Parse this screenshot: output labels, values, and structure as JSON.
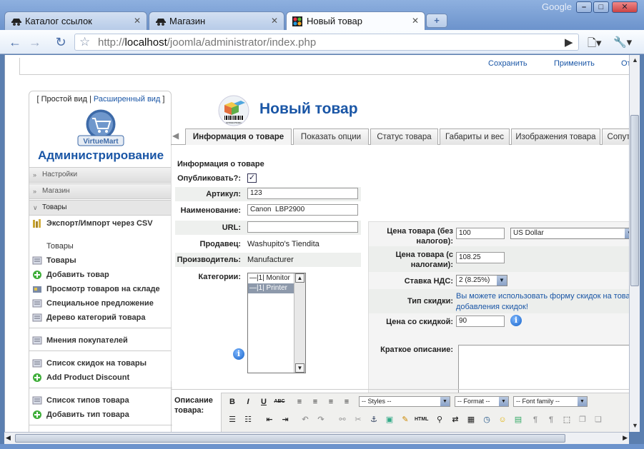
{
  "browser": {
    "tabs": [
      {
        "label": "Каталог ссылок",
        "icon": "spy-icon"
      },
      {
        "label": "Магазин",
        "icon": "spy-icon"
      },
      {
        "label": "Новый товар",
        "icon": "joomla-icon"
      }
    ],
    "new_tab": "+",
    "brand": "Google",
    "url_prefix": "http://",
    "url_host": "localhost",
    "url_path": "/joomla/administrator/index.php"
  },
  "top_actions": {
    "save": "Сохранить",
    "apply": "Применить",
    "cancel": "От"
  },
  "sidebar": {
    "view_open": "[",
    "simple_view": "Простой вид",
    "view_sep": "|",
    "extended_view": "Расширенный вид",
    "view_close": "]",
    "logo_text": "VirtueMart",
    "title": "Администрирование",
    "sections": [
      "Настройки",
      "Магазин",
      "Товары"
    ],
    "export": "Экспорт/Импорт через CSV",
    "products_heading": "Товары",
    "items": [
      "Товары",
      "Добавить товар",
      "Просмотр товаров на складе",
      "Специальное предложение",
      "Дерево категорий товара",
      "Мнения покупателей",
      "Список скидок на товары",
      "Add Product Discount",
      "Список типов товара",
      "Добавить тип товара"
    ]
  },
  "page": {
    "title": "Новый товар",
    "barcode_text": "6078943756901"
  },
  "tabs": [
    "Информация о товаре",
    "Показать опции",
    "Статус товара",
    "Габариты и вес",
    "Изображения товара",
    "Сопут"
  ],
  "form": {
    "section_title": "Информация о товаре",
    "publish_label": "Опубликовать?:",
    "publish_checked": true,
    "publish_mark": "✓",
    "sku_label": "Артикул:",
    "sku_value": "123",
    "name_label": "Наименование:",
    "name_value": "Canon  LBP2900",
    "url_label": "URL:",
    "url_value": "",
    "vendor_label": "Продавец:",
    "vendor_value": "Washupito's Tiendita",
    "manufacturer_label": "Производитель:",
    "manufacturer_value": "Manufacturer",
    "categories_label": "Категории:",
    "categories": [
      "—|1| Monitor",
      "—|1| Printer"
    ],
    "selected_category": "—|1| Printer",
    "info": "i"
  },
  "pricing": {
    "net_price_label_1": "Цена товара (без",
    "net_price_label_2": "налогов):",
    "net_price_value": "100",
    "currency": "US Dollar",
    "gross_price_label_1": "Цена товара (с",
    "gross_price_label_2": "налогами):",
    "gross_price_value": "108.25",
    "vat_label": "Ставка НДС:",
    "vat_value": "2 (8.25%)",
    "discount_type_label": "Тип скидки:",
    "discount_note_1": "Вы можете использовать форму скидок на това",
    "discount_note_2": "добавления скидок!",
    "discounted_price_label": "Цена со скидкой:",
    "discounted_price_value": "90",
    "short_desc_label": "Краткое описание:"
  },
  "description": {
    "label_1": "Описание",
    "label_2": "товара:",
    "styles": "-- Styles --",
    "format": "-- Format --",
    "font_family": "-- Font family --",
    "bold": "B",
    "italic": "I",
    "underline": "U",
    "strike": "ABC",
    "html": "HTML"
  },
  "colors": {
    "accent": "#1a56a6",
    "chrome": "#6c93cc"
  }
}
